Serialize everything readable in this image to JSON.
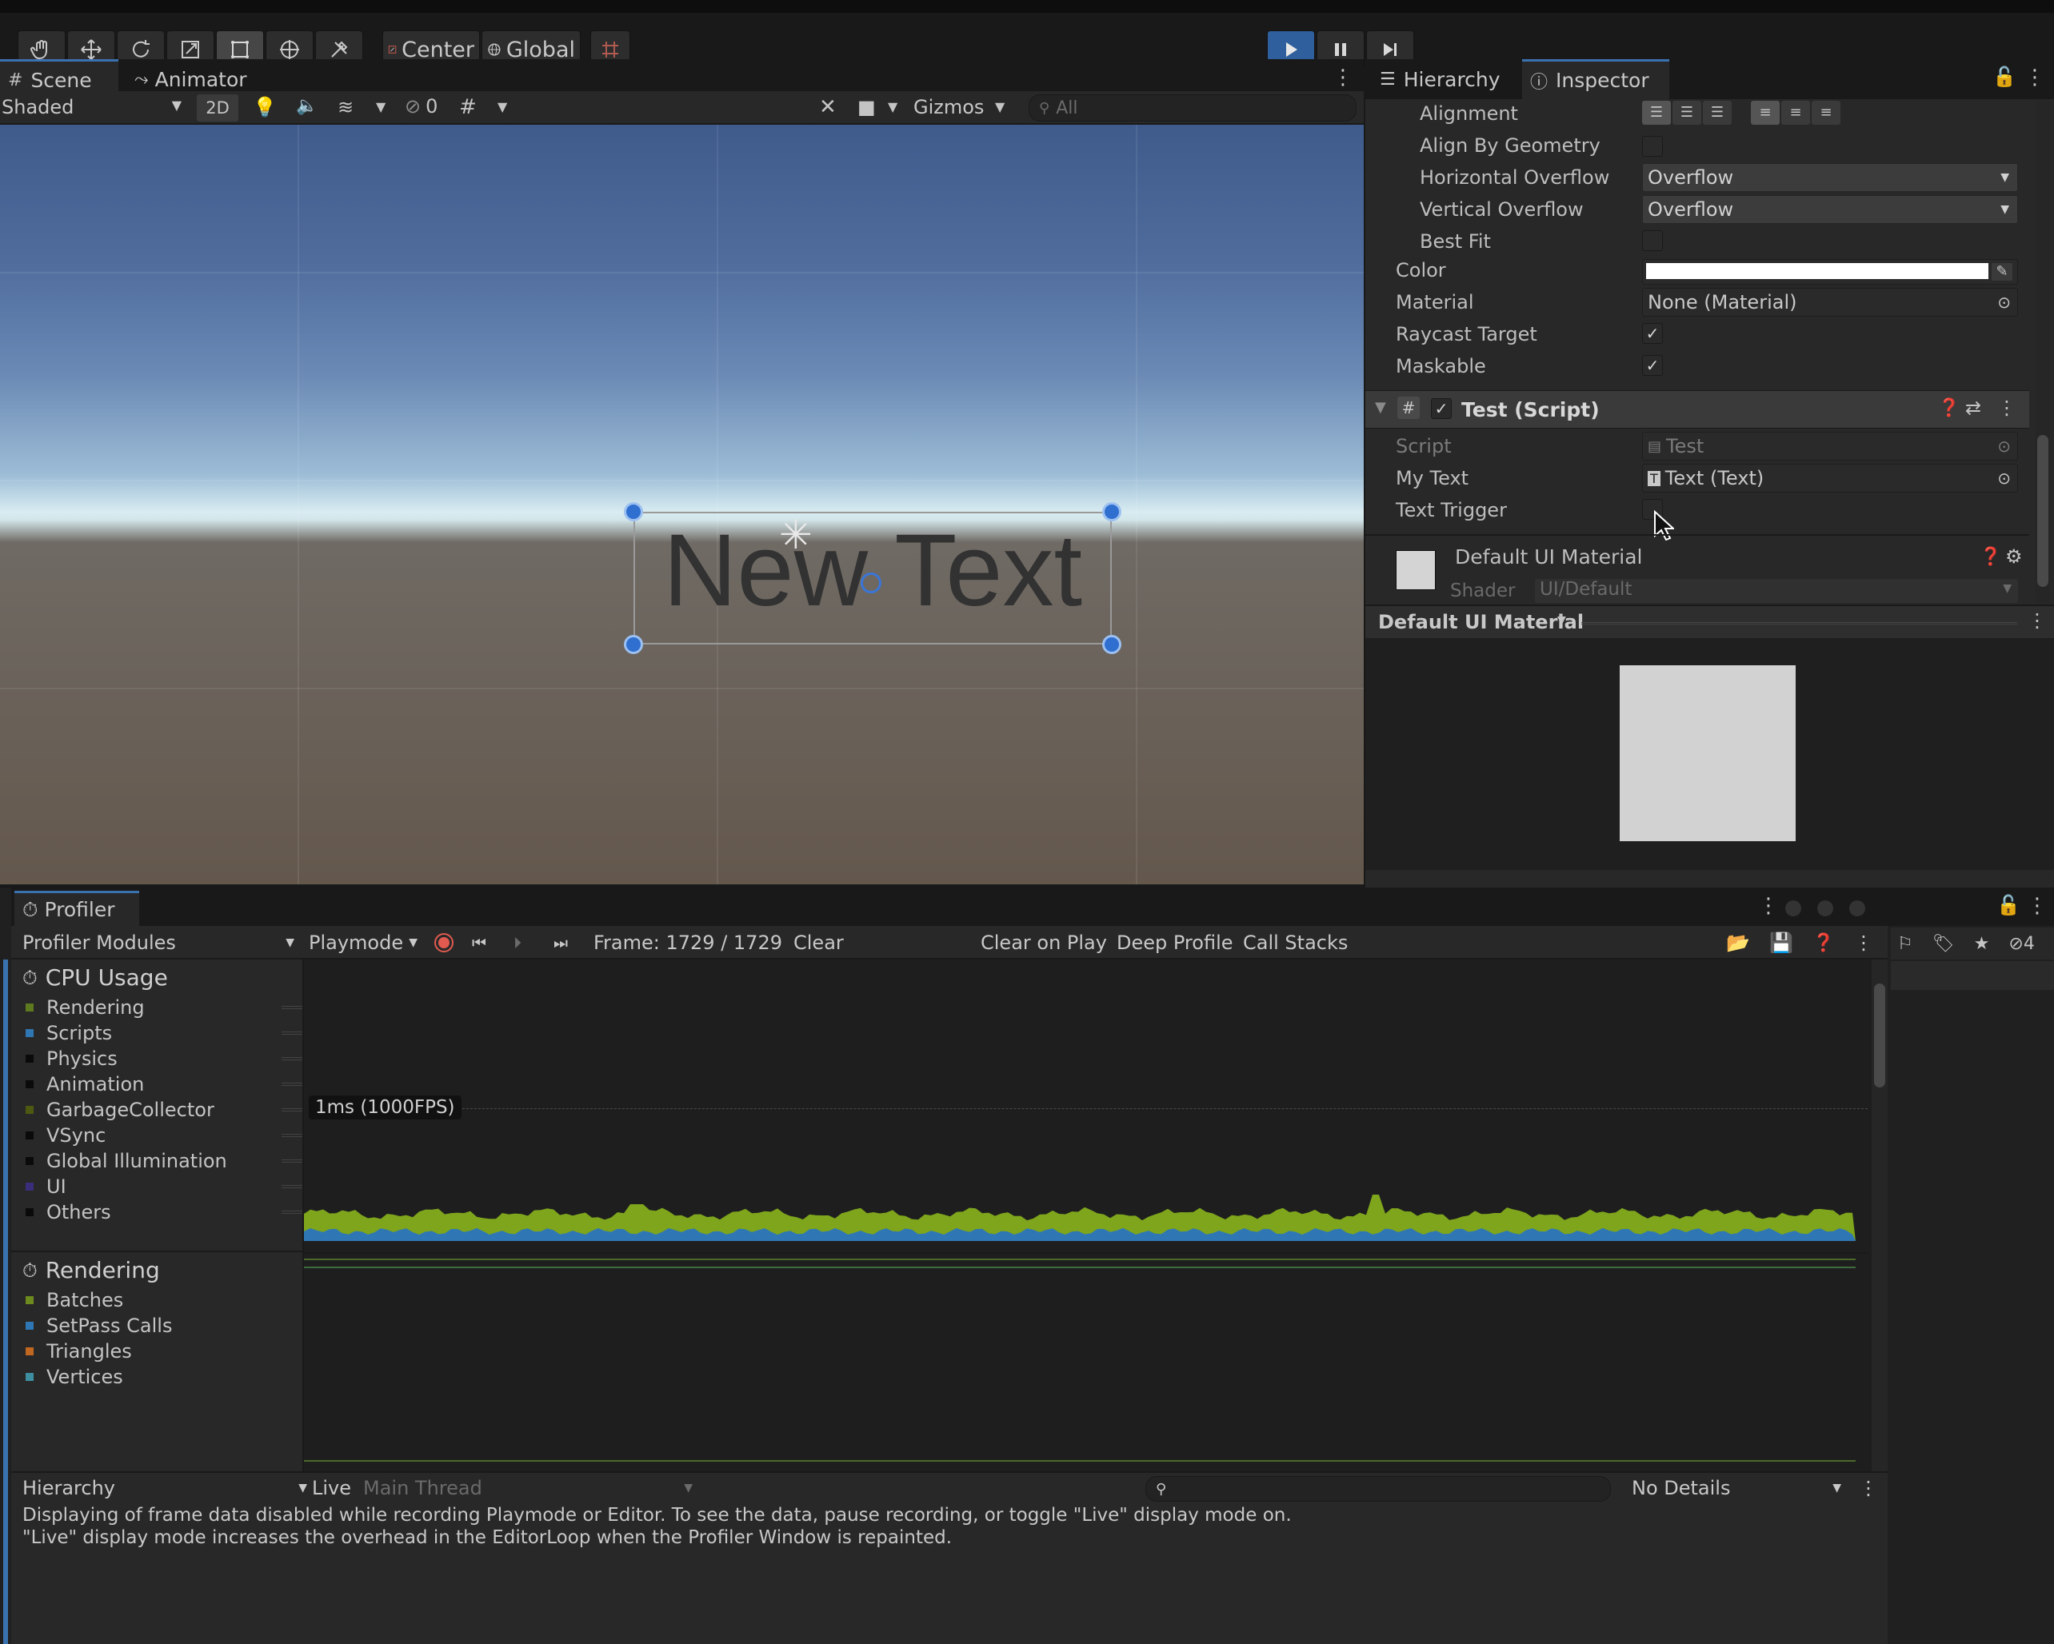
{
  "toolbar": {
    "center_label": "Center",
    "global_label": "Global"
  },
  "scene": {
    "tabs": [
      {
        "label": "Scene"
      },
      {
        "label": "Animator"
      }
    ],
    "shading_mode": "Shaded",
    "btn_2d": "2D",
    "hidden_count": "0",
    "gizmos_label": "Gizmos",
    "search_placeholder": "All",
    "selected_text": "New Text"
  },
  "inspector": {
    "tabs": [
      {
        "label": "Hierarchy"
      },
      {
        "label": "Inspector"
      }
    ],
    "rows": [
      {
        "label": "Alignment"
      },
      {
        "label": "Align By Geometry"
      },
      {
        "label": "Horizontal Overflow",
        "value": "Overflow"
      },
      {
        "label": "Vertical Overflow",
        "value": "Overflow"
      },
      {
        "label": "Best Fit"
      },
      {
        "label": "Color"
      },
      {
        "label": "Material",
        "value": "None (Material)"
      },
      {
        "label": "Raycast Target"
      },
      {
        "label": "Maskable"
      }
    ],
    "component_title": "Test (Script)",
    "script_rows": [
      {
        "label": "Script",
        "value": "Test"
      },
      {
        "label": "My Text",
        "value": "Text (Text)"
      },
      {
        "label": "Text Trigger"
      }
    ],
    "material_title": "Default UI Material",
    "shader_label": "Shader",
    "shader_value": "UI/Default",
    "preview_title": "Default UI Material"
  },
  "profiler": {
    "tab_label": "Profiler",
    "modules_label": "Profiler Modules",
    "playmode_label": "Playmode",
    "frame_label": "Frame: 1729 / 1729",
    "clear_label": "Clear",
    "clear_on_play": "Clear on Play",
    "deep_profile": "Deep Profile",
    "call_stacks": "Call Stacks",
    "cpu_title": "CPU Usage",
    "cpu_items": [
      {
        "label": "Rendering",
        "color": "#5d7a1e"
      },
      {
        "label": "Scripts",
        "color": "#2f77b4"
      },
      {
        "label": "Physics",
        "color": "#0a0a0a"
      },
      {
        "label": "Animation",
        "color": "#0a0a0a"
      },
      {
        "label": "GarbageCollector",
        "color": "#4c5a10"
      },
      {
        "label": "VSync",
        "color": "#0a0a0a"
      },
      {
        "label": "Global Illumination",
        "color": "#0a0a0a"
      },
      {
        "label": "UI",
        "color": "#3a2e7a"
      },
      {
        "label": "Others",
        "color": "#0a0a0a"
      }
    ],
    "rendering_title": "Rendering",
    "rendering_items": [
      {
        "label": "Batches",
        "color": "#6d8a1e"
      },
      {
        "label": "SetPass Calls",
        "color": "#2f77b4"
      },
      {
        "label": "Triangles",
        "color": "#c06820"
      },
      {
        "label": "Vertices",
        "color": "#3d8fa0"
      }
    ],
    "fps_label": "1ms (1000FPS)",
    "hierarchy_label": "Hierarchy",
    "live_label": "Live",
    "thread_label": "Main Thread",
    "details_label": "No Details",
    "message_line1": "Displaying of frame data disabled while recording Playmode or Editor. To see the data, pause recording, or toggle \"Live\" display mode on.",
    "message_line2": "\"Live\" display mode increases the overhead in the EditorLoop when the Profiler Window is repainted."
  },
  "right_strip": {
    "count": "4"
  }
}
